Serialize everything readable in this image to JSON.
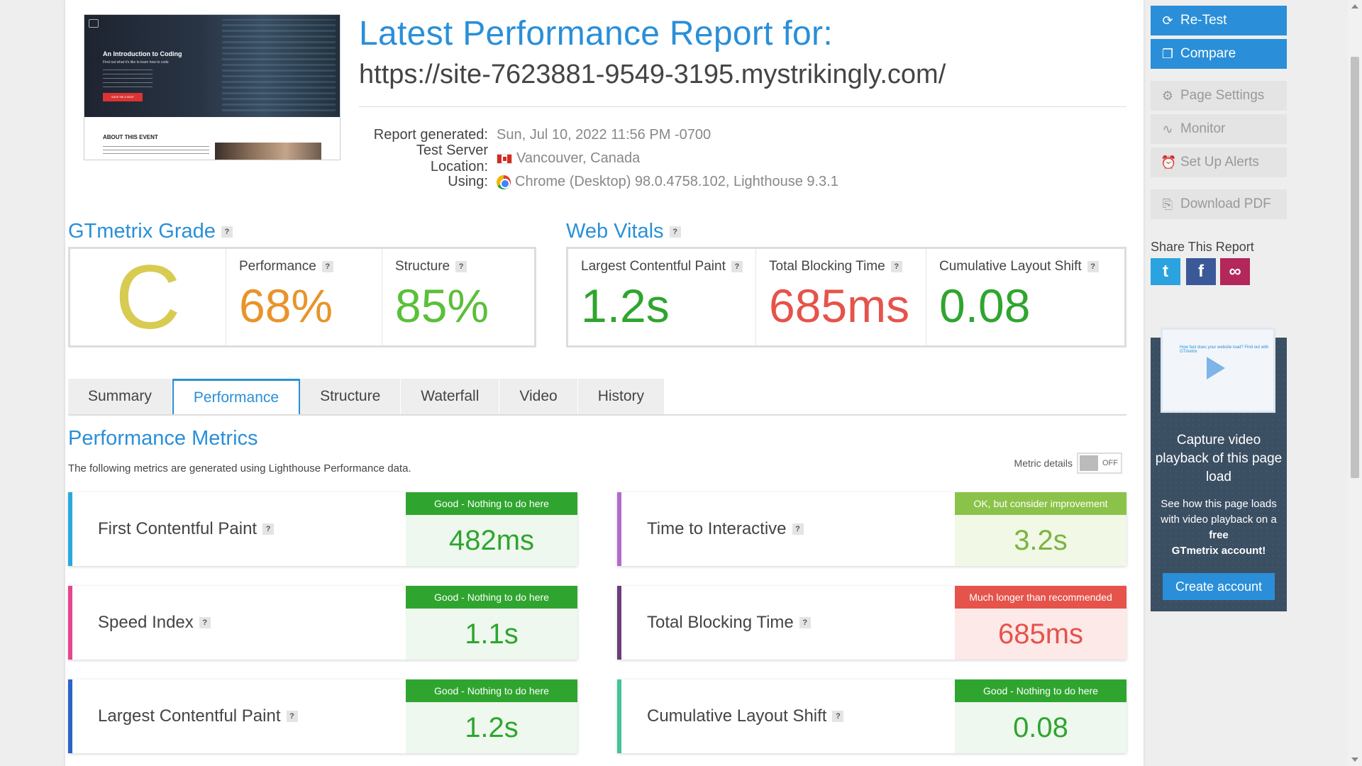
{
  "thumbnail": {
    "headline": "An Introduction to Coding",
    "subline": "Find out what it's like to learn how to code",
    "button": "SAVE ME A SEAT",
    "about": "ABOUT THIS EVENT"
  },
  "header": {
    "title": "Latest Performance Report for:",
    "url": "https://site-7623881-9549-3195.mystrikingly.com/"
  },
  "meta": {
    "generated_label": "Report generated:",
    "generated_value": "Sun, Jul 10, 2022 11:56 PM -0700",
    "location_label": "Test Server Location:",
    "location_value": "Vancouver, Canada",
    "using_label": "Using:",
    "using_value": "Chrome (Desktop) 98.0.4758.102, Lighthouse 9.3.1"
  },
  "grade": {
    "title": "GTmetrix Grade",
    "letter": "C",
    "performance_label": "Performance",
    "performance_value": "68%",
    "structure_label": "Structure",
    "structure_value": "85%"
  },
  "vitals": {
    "title": "Web Vitals",
    "lcp_label": "Largest Contentful Paint",
    "lcp_value": "1.2s",
    "tbt_label": "Total Blocking Time",
    "tbt_value": "685ms",
    "cls_label": "Cumulative Layout Shift",
    "cls_value": "0.08"
  },
  "tabs": [
    "Summary",
    "Performance",
    "Structure",
    "Waterfall",
    "Video",
    "History"
  ],
  "perf": {
    "title": "Performance Metrics",
    "description": "The following metrics are generated using Lighthouse Performance data.",
    "metric_details_label": "Metric details",
    "toggle_state": "OFF"
  },
  "metrics": [
    {
      "name": "First Contentful Paint",
      "badge": "Good - Nothing to do here",
      "value": "482ms",
      "bar_color": "#29a8e0"
    },
    {
      "name": "Time to Interactive",
      "badge": "OK, but consider improvement",
      "value": "3.2s",
      "bar_color": "#b06ccb"
    },
    {
      "name": "Speed Index",
      "badge": "Good - Nothing to do here",
      "value": "1.1s",
      "bar_color": "#e6458f"
    },
    {
      "name": "Total Blocking Time",
      "badge": "Much longer than recommended",
      "value": "685ms",
      "bar_color": "#6b3d7a"
    },
    {
      "name": "Largest Contentful Paint",
      "badge": "Good - Nothing to do here",
      "value": "1.2s",
      "bar_color": "#2a63c9"
    },
    {
      "name": "Cumulative Layout Shift",
      "badge": "Good - Nothing to do here",
      "value": "0.08",
      "bar_color": "#45c39b"
    }
  ],
  "colors": {
    "accent": "#2a8fd8",
    "good": "#2fa52f",
    "ok": "#8bc34a",
    "bad": "#e5534b",
    "grade_c": "#d8cb52",
    "perf_orange": "#e8942a"
  },
  "sidebar": {
    "retest": "Re-Test",
    "compare": "Compare",
    "page_settings": "Page Settings",
    "monitor": "Monitor",
    "alerts": "Set Up Alerts",
    "pdf": "Download PDF",
    "share_title": "Share This Report",
    "promo_headline": "Capture video playback of this page load",
    "promo_text_1": "See how this page loads with video playback on a",
    "promo_text_bold_1": "free",
    "promo_text_bold_2": "GTmetrix account!",
    "promo_cta": "Create account",
    "promo_thumb_text": "How fast does your website load? Find out with GTmetrix"
  }
}
